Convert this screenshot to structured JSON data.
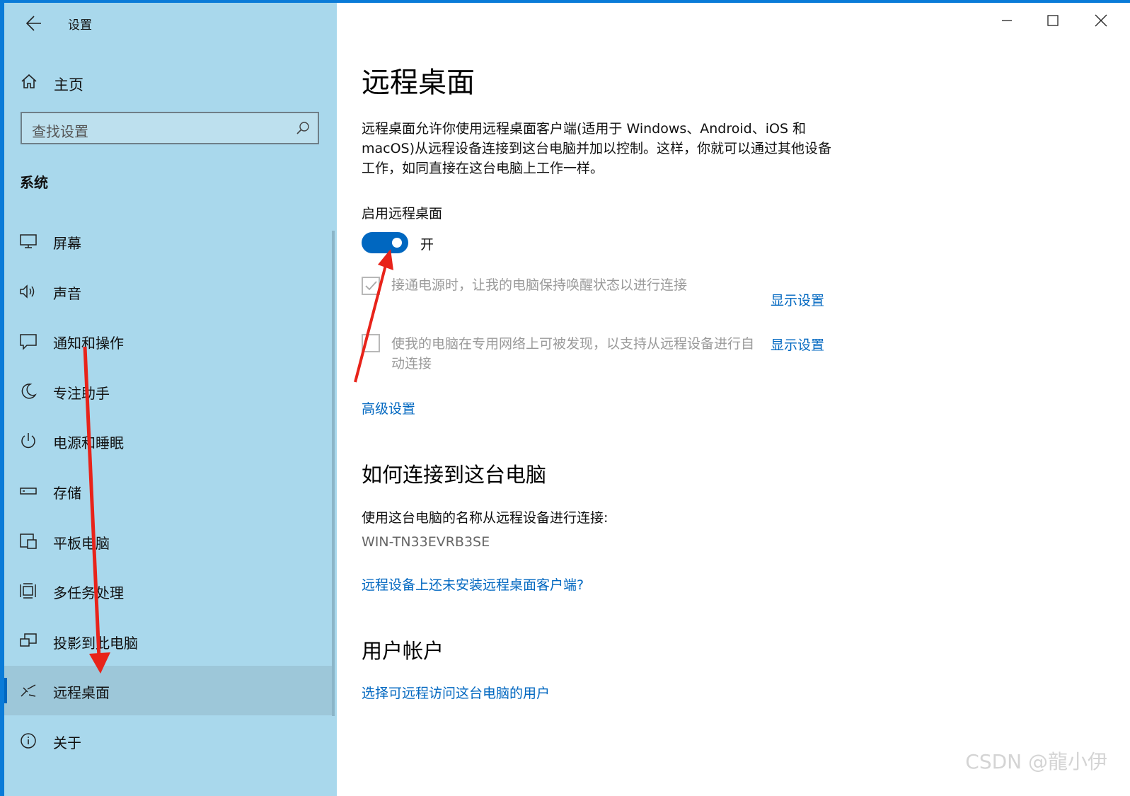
{
  "app": {
    "title": "设置"
  },
  "sidebar": {
    "home": "主页",
    "search_placeholder": "查找设置",
    "section": "系统",
    "items": [
      {
        "label": "屏幕",
        "icon": "monitor-icon"
      },
      {
        "label": "声音",
        "icon": "speaker-icon"
      },
      {
        "label": "通知和操作",
        "icon": "notification-icon"
      },
      {
        "label": "专注助手",
        "icon": "moon-icon"
      },
      {
        "label": "电源和睡眠",
        "icon": "power-icon"
      },
      {
        "label": "存储",
        "icon": "storage-icon"
      },
      {
        "label": "平板电脑",
        "icon": "tablet-icon"
      },
      {
        "label": "多任务处理",
        "icon": "multitask-icon"
      },
      {
        "label": "投影到此电脑",
        "icon": "project-icon"
      },
      {
        "label": "远程桌面",
        "icon": "remote-desktop-icon",
        "active": true
      },
      {
        "label": "关于",
        "icon": "info-icon"
      }
    ]
  },
  "main": {
    "title": "远程桌面",
    "description": "远程桌面允许你使用远程桌面客户端(适用于 Windows、Android、iOS 和 macOS)从远程设备连接到这台电脑并加以控制。这样，你就可以通过其他设备工作，如同直接在这台电脑上工作一样。",
    "enable_label": "启用远程桌面",
    "toggle_state": "开",
    "toggle_on": true,
    "option1": {
      "text": "接通电源时，让我的电脑保持唤醒状态以进行连接",
      "checked": true,
      "link": "显示设置"
    },
    "option2": {
      "text": "使我的电脑在专用网络上可被发现，以支持从远程设备进行自动连接",
      "checked": false,
      "link": "显示设置"
    },
    "advanced_link": "高级设置",
    "how_heading": "如何连接到这台电脑",
    "how_text": "使用这台电脑的名称从远程设备进行连接:",
    "pc_name": "WIN-TN33EVRB3SE",
    "client_link": "远程设备上还未安装远程桌面客户端?",
    "accounts_heading": "用户帐户",
    "accounts_link": "选择可远程访问这台电脑的用户"
  },
  "watermark": "CSDN @龍小伊",
  "colors": {
    "accent": "#0067c0",
    "sidebar_bg": "#a9d8ec",
    "arrow": "#e8231a"
  }
}
